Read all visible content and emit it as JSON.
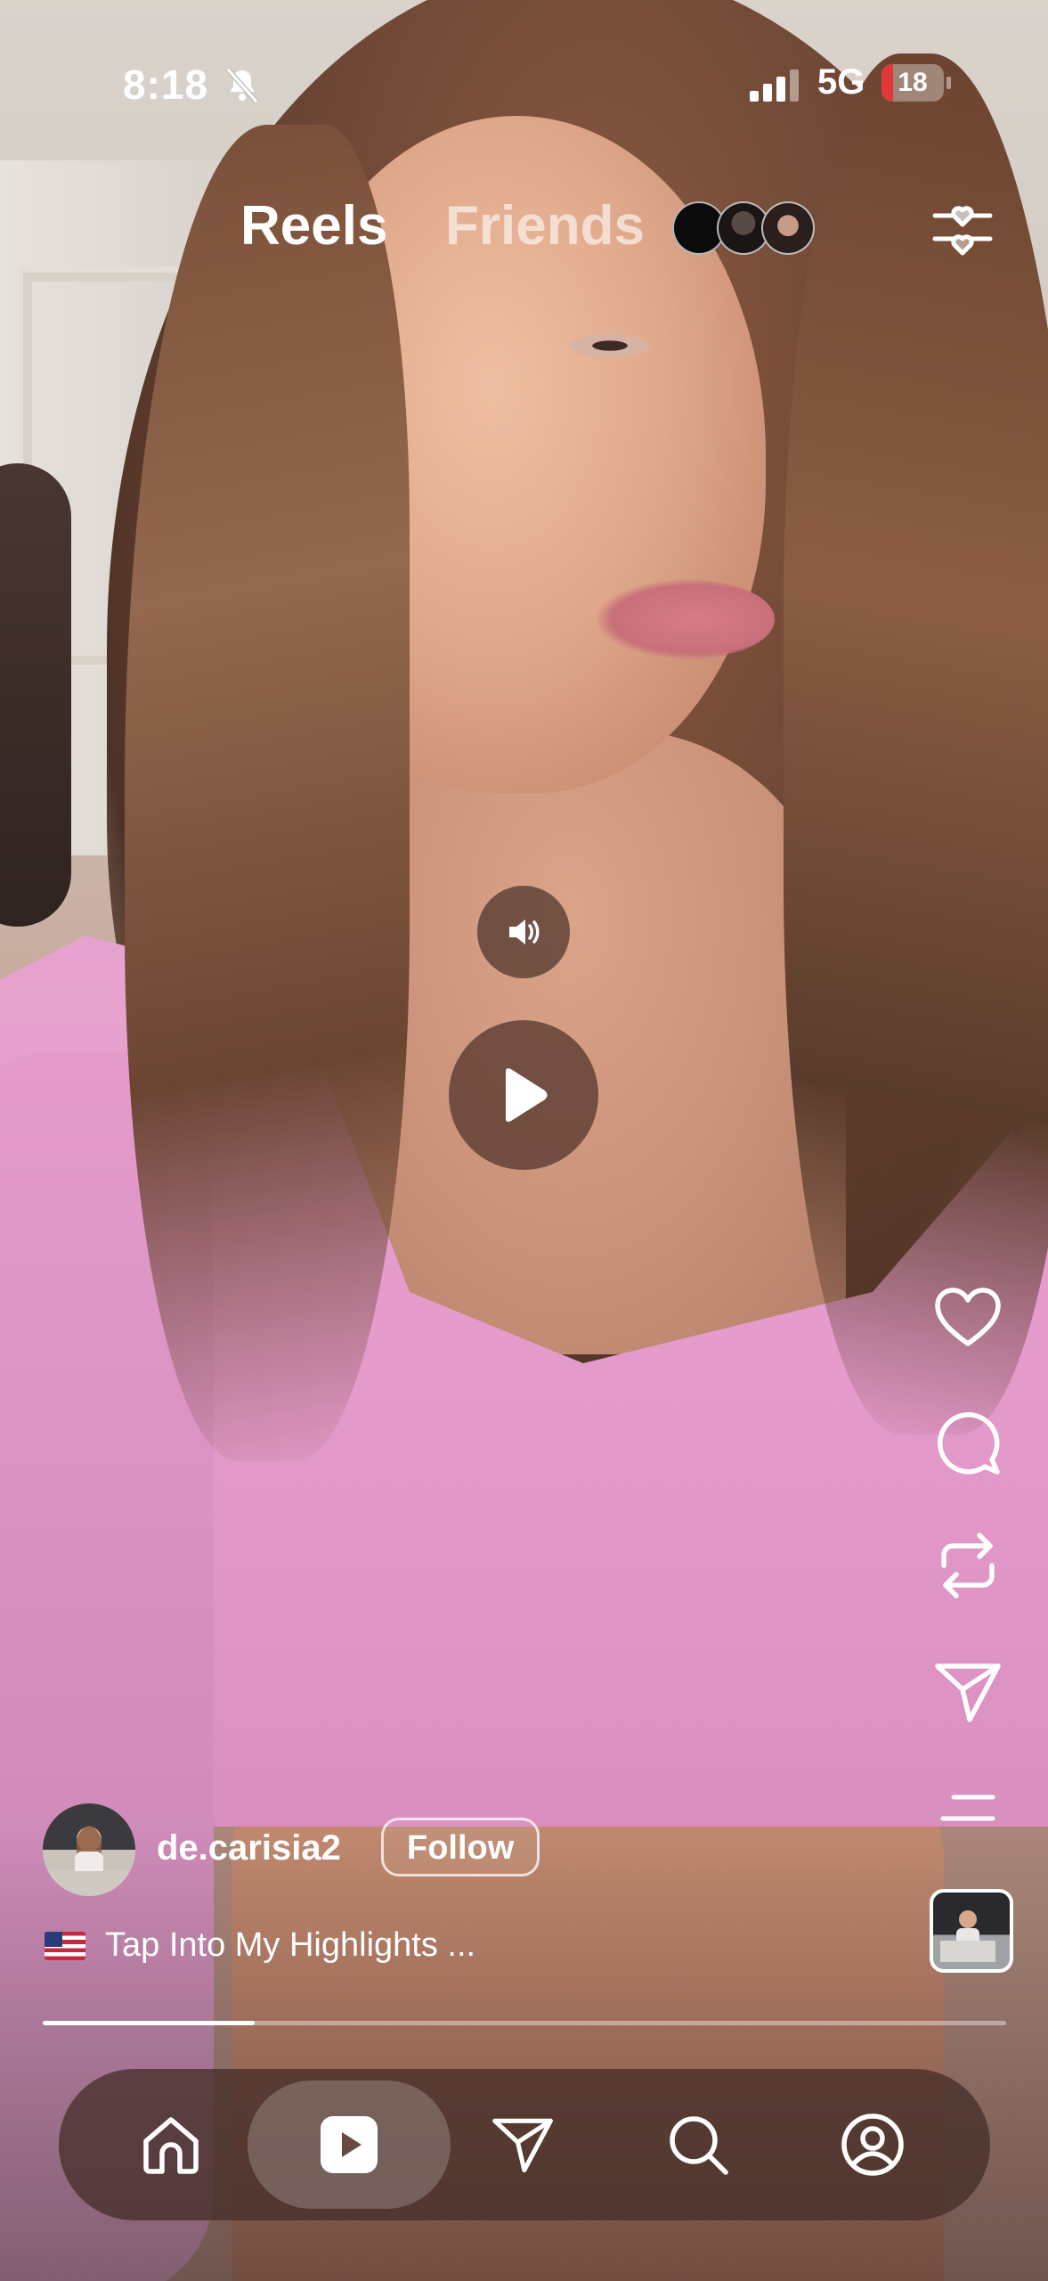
{
  "status_bar": {
    "time": "8:18",
    "network": "5G",
    "battery_level": "18",
    "battery_fraction": 0.18,
    "icons": [
      "bell-slash-icon",
      "cellular-signal-icon",
      "battery-icon"
    ],
    "battery_color": "#e0383b"
  },
  "header": {
    "tabs": [
      {
        "label": "Reels",
        "active": true
      },
      {
        "label": "Friends",
        "active": false
      }
    ],
    "friend_avatars_count": 3,
    "filter_icon": "heart-sliders-icon"
  },
  "video": {
    "sound_icon": "speaker-icon",
    "play_icon": "play-icon",
    "progress_fraction": 0.22
  },
  "actions": {
    "icons": [
      "heart-icon",
      "comment-icon",
      "repost-icon",
      "send-icon",
      "more-icon",
      "audio-thumbnail"
    ]
  },
  "author": {
    "username": "de.carisia2",
    "follow_label": "Follow"
  },
  "caption": {
    "flag": "us-flag-icon",
    "text": "Tap Into My Highlights ..."
  },
  "bottom_nav": {
    "items": [
      "home-icon",
      "reels-icon",
      "messages-icon",
      "search-icon",
      "profile-icon"
    ],
    "active": "reels-icon"
  }
}
